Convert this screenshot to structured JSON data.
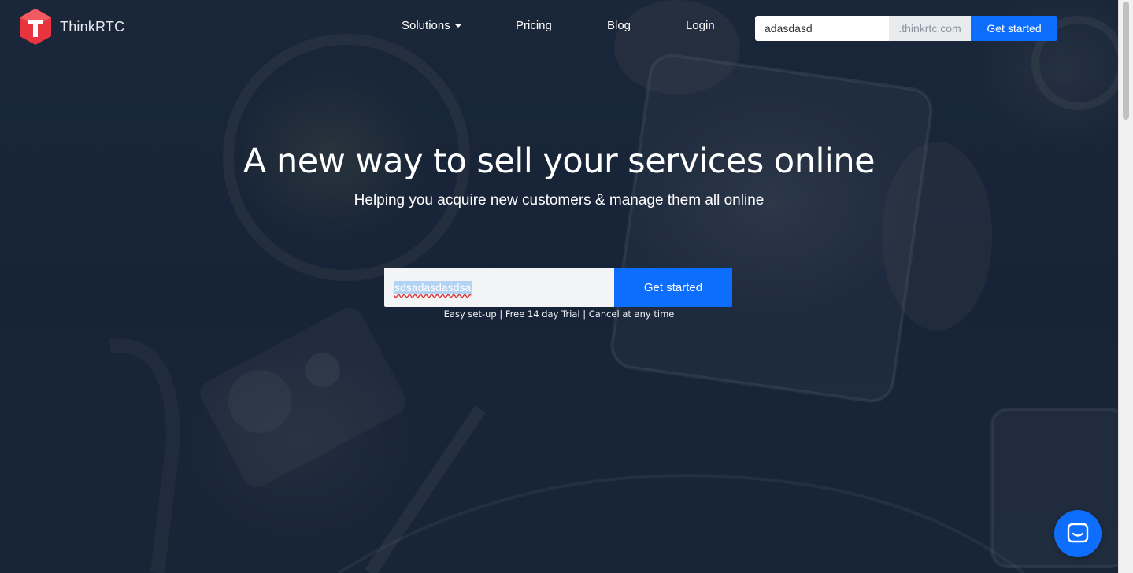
{
  "brand": {
    "name": "ThinkRTC",
    "logo_color": "#e8343f"
  },
  "nav": {
    "items": [
      {
        "label": "Solutions",
        "has_dropdown": true
      },
      {
        "label": "Pricing"
      },
      {
        "label": "Blog"
      },
      {
        "label": "Login"
      }
    ]
  },
  "header_signup": {
    "subdomain_value": "adasdasd",
    "domain_suffix": ".thinkrtc.com",
    "button_label": "Get started"
  },
  "hero": {
    "title": "A new way to sell your services online",
    "subtitle": "Helping you acquire new customers & manage them all online",
    "input_value": "sdsadasdasdsa",
    "button_label": "Get started",
    "tagline": "Easy set-up  |  Free 14 day Trial  |  Cancel at any time"
  },
  "chat": {
    "icon": "chat-bubble-icon"
  },
  "colors": {
    "accent": "#0d6efd",
    "background": "#1a2638"
  }
}
